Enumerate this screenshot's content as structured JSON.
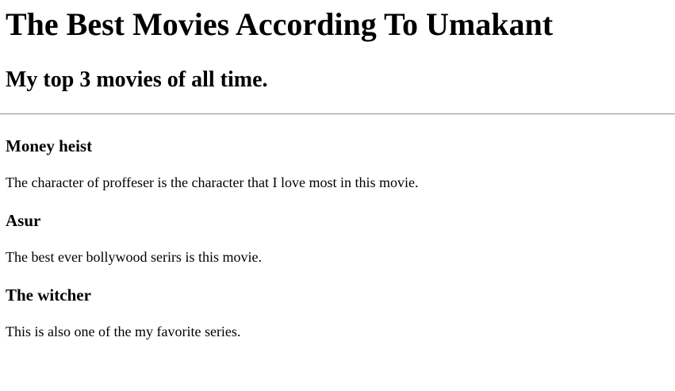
{
  "header": {
    "title": "The Best Movies According To Umakant",
    "subtitle": "My top 3 movies of all time."
  },
  "movies": [
    {
      "title": "Money heist",
      "description": "The character of proffeser is the character that I love most in this movie."
    },
    {
      "title": "Asur",
      "description": "The best ever bollywood serirs is this movie."
    },
    {
      "title": "The witcher",
      "description": "This is also one of the my favorite series."
    }
  ]
}
